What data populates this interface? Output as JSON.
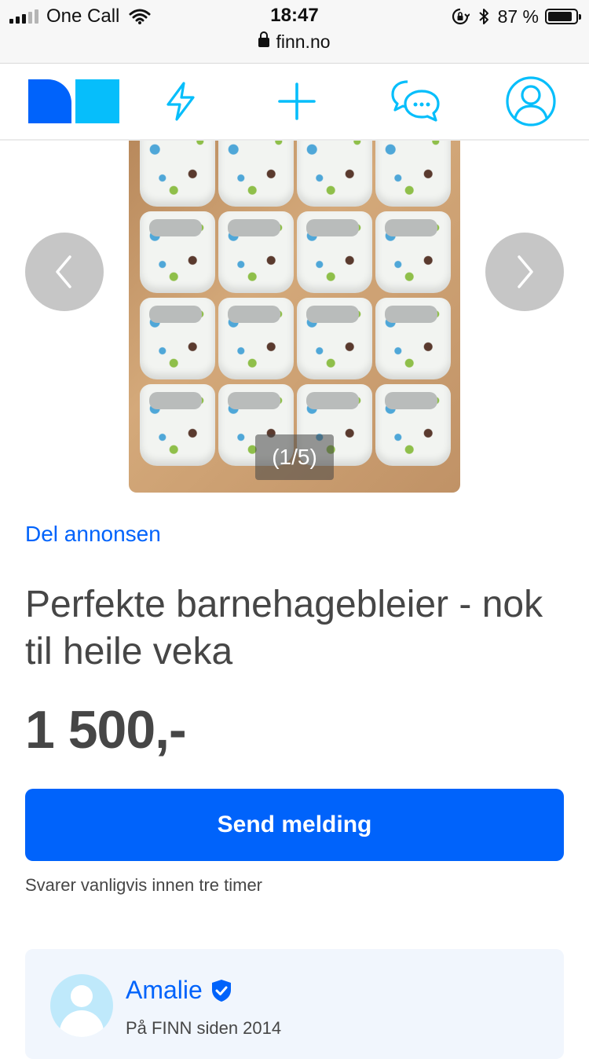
{
  "status_bar": {
    "carrier": "One Call",
    "time": "18:47",
    "url": "finn.no",
    "battery_percent": "87 %",
    "battery_level": 0.87,
    "signal_bars": 5,
    "signal_active": 3
  },
  "nav": {
    "icons": [
      "finn-logo",
      "lightning-icon",
      "plus-icon",
      "chat-icon",
      "profile-icon"
    ],
    "accent_color": "#0063fb",
    "icon_color": "#06befb"
  },
  "carousel": {
    "counter": "(1/5)",
    "current": 1,
    "total": 5
  },
  "share_link": "Del annonsen",
  "listing": {
    "title": "Perfekte barnehagebleier - nok til heile veka",
    "price": "1 500,-"
  },
  "contact": {
    "button_label": "Send melding",
    "reply_time": "Svarer vanligvis innen tre timer",
    "button_color": "#0063fb"
  },
  "seller": {
    "name": "Amalie",
    "member_since": "På FINN siden 2014",
    "verified": true
  }
}
